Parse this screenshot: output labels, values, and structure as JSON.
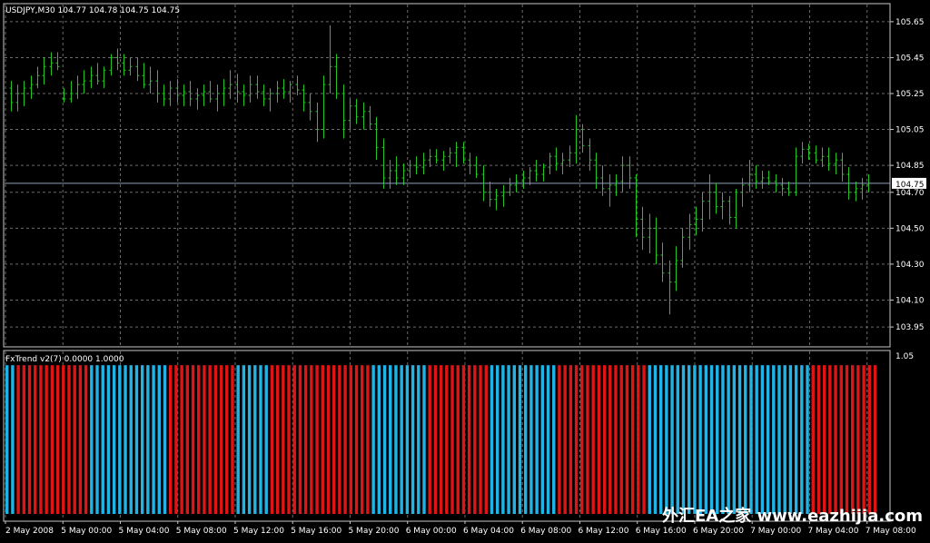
{
  "window": {
    "main_header": "USDJPY,M30  104.77 104.78 104.75 104.75",
    "indicator_header": "FxTrend v2(7) 0.0000 1.0000",
    "watermark": "外汇EA之家 www.eazhijia.com"
  },
  "colors": {
    "background": "#000000",
    "grid": "#6b6b6b",
    "candle": "#22c322",
    "up_bar": "#1fb3e6",
    "down_bar": "#e01414",
    "price_line": "#8aa0b8"
  },
  "chart_data": [
    {
      "type": "bar",
      "title": "USDJPY,M30",
      "ohlc_header": "104.77 104.78 104.75 104.75",
      "ylim": [
        103.9,
        105.7
      ],
      "grid": true,
      "y_ticks": [
        "105.65",
        "105.45",
        "105.25",
        "105.05",
        "104.85",
        "104.70",
        "104.50",
        "104.30",
        "104.10",
        "103.95"
      ],
      "y_tick_values": [
        105.65,
        105.45,
        105.25,
        105.05,
        104.85,
        104.7,
        104.5,
        104.3,
        104.1,
        103.95
      ],
      "current_price": "104.75",
      "x_ticks": [
        "2 May 2008",
        "5 May 00:00",
        "5 May 04:00",
        "5 May 08:00",
        "5 May 12:00",
        "5 May 16:00",
        "5 May 20:00",
        "6 May 00:00",
        "6 May 04:00",
        "6 May 08:00",
        "6 May 12:00",
        "6 May 16:00",
        "6 May 20:00",
        "7 May 00:00",
        "7 May 04:00",
        "7 May 08:00"
      ],
      "ohlc": [
        [
          105.28,
          105.32,
          105.15,
          105.2
        ],
        [
          105.2,
          105.3,
          105.15,
          105.25
        ],
        [
          105.25,
          105.32,
          105.18,
          105.28
        ],
        [
          105.28,
          105.35,
          105.22,
          105.3
        ],
        [
          105.3,
          105.4,
          105.28,
          105.35
        ],
        [
          105.35,
          105.45,
          105.3,
          105.4
        ],
        [
          105.4,
          105.48,
          105.35,
          105.42
        ],
        [
          105.42,
          105.48,
          105.38,
          105.4
        ],
        [
          105.22,
          105.28,
          105.2,
          105.22
        ],
        [
          105.22,
          105.32,
          105.2,
          105.25
        ],
        [
          105.25,
          105.35,
          105.22,
          105.3
        ],
        [
          105.3,
          105.38,
          105.25,
          105.32
        ],
        [
          105.32,
          105.4,
          105.28,
          105.35
        ],
        [
          105.35,
          105.42,
          105.3,
          105.32
        ],
        [
          105.32,
          105.4,
          105.28,
          105.38
        ],
        [
          105.38,
          105.47,
          105.35,
          105.45
        ],
        [
          105.45,
          105.5,
          105.38,
          105.42
        ],
        [
          105.42,
          105.47,
          105.35,
          105.38
        ],
        [
          105.38,
          105.45,
          105.35,
          105.4
        ],
        [
          105.4,
          105.45,
          105.32,
          105.35
        ],
        [
          105.35,
          105.42,
          105.28,
          105.3
        ],
        [
          105.3,
          105.4,
          105.25,
          105.32
        ],
        [
          105.32,
          105.38,
          105.2,
          105.25
        ],
        [
          105.25,
          105.3,
          105.18,
          105.22
        ],
        [
          105.22,
          105.32,
          105.18,
          105.28
        ],
        [
          105.28,
          105.33,
          105.2,
          105.24
        ],
        [
          105.24,
          105.3,
          105.18,
          105.26
        ],
        [
          105.26,
          105.32,
          105.18,
          105.22
        ],
        [
          105.22,
          105.28,
          105.16,
          105.24
        ],
        [
          105.24,
          105.3,
          105.18,
          105.26
        ],
        [
          105.26,
          105.32,
          105.2,
          105.22
        ],
        [
          105.22,
          105.3,
          105.15,
          105.25
        ],
        [
          105.25,
          105.33,
          105.18,
          105.28
        ],
        [
          105.28,
          105.38,
          105.22,
          105.3
        ],
        [
          105.3,
          105.36,
          105.2,
          105.26
        ],
        [
          105.26,
          105.3,
          105.18,
          105.24
        ],
        [
          105.24,
          105.35,
          105.2,
          105.3
        ],
        [
          105.3,
          105.35,
          105.22,
          105.26
        ],
        [
          105.26,
          105.3,
          105.18,
          105.22
        ],
        [
          105.22,
          105.28,
          105.15,
          105.25
        ],
        [
          105.25,
          105.32,
          105.2,
          105.28
        ],
        [
          105.28,
          105.33,
          105.22,
          105.26
        ],
        [
          105.26,
          105.32,
          105.2,
          105.3
        ],
        [
          105.3,
          105.35,
          105.24,
          105.27
        ],
        [
          105.27,
          105.3,
          105.15,
          105.2
        ],
        [
          105.2,
          105.25,
          105.1,
          105.15
        ],
        [
          105.15,
          105.2,
          104.98,
          105.05
        ],
        [
          105.05,
          105.35,
          105.0,
          105.3
        ],
        [
          105.3,
          105.63,
          105.25,
          105.4
        ],
        [
          105.4,
          105.47,
          105.22,
          105.25
        ],
        [
          105.25,
          105.3,
          105.0,
          105.1
        ],
        [
          105.1,
          105.22,
          105.05,
          105.18
        ],
        [
          105.18,
          105.22,
          105.08,
          105.12
        ],
        [
          105.12,
          105.2,
          105.05,
          105.15
        ],
        [
          105.15,
          105.18,
          105.05,
          105.08
        ],
        [
          105.08,
          105.12,
          104.88,
          104.95
        ],
        [
          104.95,
          105.0,
          104.72,
          104.78
        ],
        [
          104.78,
          104.88,
          104.72,
          104.82
        ],
        [
          104.82,
          104.9,
          104.74,
          104.78
        ],
        [
          104.78,
          104.86,
          104.74,
          104.82
        ],
        [
          104.82,
          104.88,
          104.78,
          104.85
        ],
        [
          104.85,
          104.9,
          104.8,
          104.84
        ],
        [
          104.84,
          104.92,
          104.8,
          104.88
        ],
        [
          104.88,
          104.94,
          104.84,
          104.9
        ],
        [
          104.9,
          104.94,
          104.86,
          104.88
        ],
        [
          104.88,
          104.93,
          104.82,
          104.9
        ],
        [
          104.9,
          104.95,
          104.86,
          104.92
        ],
        [
          104.92,
          104.98,
          104.84,
          104.95
        ],
        [
          104.95,
          104.98,
          104.86,
          104.88
        ],
        [
          104.88,
          104.92,
          104.8,
          104.85
        ],
        [
          104.85,
          104.9,
          104.78,
          104.8
        ],
        [
          104.8,
          104.85,
          104.65,
          104.7
        ],
        [
          104.7,
          104.76,
          104.62,
          104.66
        ],
        [
          104.66,
          104.72,
          104.6,
          104.68
        ],
        [
          104.68,
          104.74,
          104.62,
          104.7
        ],
        [
          104.7,
          104.78,
          104.68,
          104.74
        ],
        [
          104.74,
          104.8,
          104.7,
          104.76
        ],
        [
          104.76,
          104.82,
          104.72,
          104.78
        ],
        [
          104.78,
          104.84,
          104.74,
          104.82
        ],
        [
          104.82,
          104.88,
          104.76,
          104.8
        ],
        [
          104.8,
          104.86,
          104.76,
          104.84
        ],
        [
          104.84,
          104.92,
          104.8,
          104.9
        ],
        [
          104.9,
          104.95,
          104.82,
          104.86
        ],
        [
          104.86,
          104.92,
          104.8,
          104.88
        ],
        [
          104.88,
          104.96,
          104.84,
          104.92
        ],
        [
          104.92,
          105.13,
          104.86,
          105.05
        ],
        [
          105.05,
          105.08,
          104.92,
          104.96
        ],
        [
          104.96,
          105.0,
          104.82,
          104.88
        ],
        [
          104.88,
          104.92,
          104.72,
          104.78
        ],
        [
          104.78,
          104.85,
          104.68,
          104.72
        ],
        [
          104.72,
          104.8,
          104.62,
          104.74
        ],
        [
          104.74,
          104.8,
          104.68,
          104.76
        ],
        [
          104.76,
          104.9,
          104.7,
          104.85
        ],
        [
          104.85,
          104.9,
          104.72,
          104.78
        ],
        [
          104.78,
          104.8,
          104.45,
          104.55
        ],
        [
          104.55,
          104.62,
          104.38,
          104.45
        ],
        [
          104.45,
          104.58,
          104.36,
          104.5
        ],
        [
          104.5,
          104.56,
          104.3,
          104.35
        ],
        [
          104.35,
          104.42,
          104.2,
          104.25
        ],
        [
          104.25,
          104.32,
          104.02,
          104.2
        ],
        [
          104.2,
          104.4,
          104.15,
          104.32
        ],
        [
          104.32,
          104.5,
          104.28,
          104.45
        ],
        [
          104.45,
          104.58,
          104.38,
          104.52
        ],
        [
          104.52,
          104.62,
          104.46,
          104.55
        ],
        [
          104.55,
          104.7,
          104.48,
          104.65
        ],
        [
          104.65,
          104.8,
          104.55,
          104.7
        ],
        [
          104.7,
          104.75,
          104.58,
          104.62
        ],
        [
          104.62,
          104.7,
          104.55,
          104.65
        ],
        [
          104.65,
          104.68,
          104.52,
          104.56
        ],
        [
          104.56,
          104.72,
          104.5,
          104.7
        ],
        [
          104.7,
          104.78,
          104.62,
          104.74
        ],
        [
          104.74,
          104.88,
          104.7,
          104.8
        ],
        [
          104.8,
          104.85,
          104.72,
          104.76
        ],
        [
          104.76,
          104.82,
          104.72,
          104.78
        ],
        [
          104.78,
          104.82,
          104.74,
          104.76
        ],
        [
          104.76,
          104.8,
          104.7,
          104.74
        ],
        [
          104.74,
          104.78,
          104.68,
          104.72
        ],
        [
          104.72,
          104.76,
          104.68,
          104.7
        ],
        [
          104.7,
          104.95,
          104.68,
          104.9
        ],
        [
          104.9,
          104.98,
          104.86,
          104.94
        ],
        [
          104.94,
          104.97,
          104.88,
          104.92
        ],
        [
          104.92,
          104.96,
          104.86,
          104.88
        ],
        [
          104.88,
          104.95,
          104.84,
          104.9
        ],
        [
          104.9,
          104.95,
          104.82,
          104.86
        ],
        [
          104.86,
          104.92,
          104.8,
          104.88
        ],
        [
          104.88,
          104.92,
          104.76,
          104.8
        ],
        [
          104.8,
          104.84,
          104.66,
          104.7
        ],
        [
          104.7,
          104.76,
          104.65,
          104.72
        ],
        [
          104.72,
          104.78,
          104.66,
          104.74
        ],
        [
          104.74,
          104.8,
          104.7,
          104.75
        ]
      ]
    },
    {
      "type": "bar",
      "title": "FxTrend v2(7)",
      "values_header": "0.0000 1.0000",
      "ylim": [
        0,
        1.05
      ],
      "y_ticks": [
        "1.05"
      ],
      "series": [
        {
          "name": "up",
          "color": "#1fb3e6"
        },
        {
          "name": "down",
          "color": "#e01414"
        }
      ],
      "values": [
        1,
        1,
        0,
        0,
        0,
        0,
        0,
        0,
        0,
        0,
        0,
        0,
        0,
        0,
        0,
        1,
        1,
        1,
        1,
        1,
        1,
        1,
        1,
        1,
        1,
        1,
        1,
        1,
        1,
        0,
        0,
        0,
        0,
        0,
        0,
        0,
        0,
        0,
        0,
        0,
        0,
        1,
        1,
        1,
        1,
        1,
        1,
        0,
        0,
        0,
        0,
        0,
        0,
        0,
        0,
        0,
        0,
        0,
        0,
        0,
        0,
        0,
        0,
        0,
        0,
        1,
        1,
        1,
        1,
        1,
        1,
        1,
        1,
        1,
        1,
        0,
        0,
        0,
        0,
        0,
        0,
        0,
        0,
        0,
        0,
        0,
        1,
        1,
        1,
        1,
        1,
        1,
        1,
        1,
        1,
        1,
        1,
        1,
        0,
        0,
        0,
        0,
        0,
        0,
        0,
        0,
        0,
        0,
        0,
        0,
        0,
        0,
        0,
        0,
        1,
        1,
        1,
        1,
        1,
        1,
        1,
        1,
        1,
        1,
        1,
        1,
        1,
        1,
        1,
        1,
        1,
        1,
        1,
        1,
        1,
        1,
        1,
        1,
        1,
        1,
        1,
        1,
        1,
        0,
        0,
        0,
        0,
        0,
        0,
        0,
        0,
        0,
        0,
        0,
        0
      ]
    }
  ]
}
